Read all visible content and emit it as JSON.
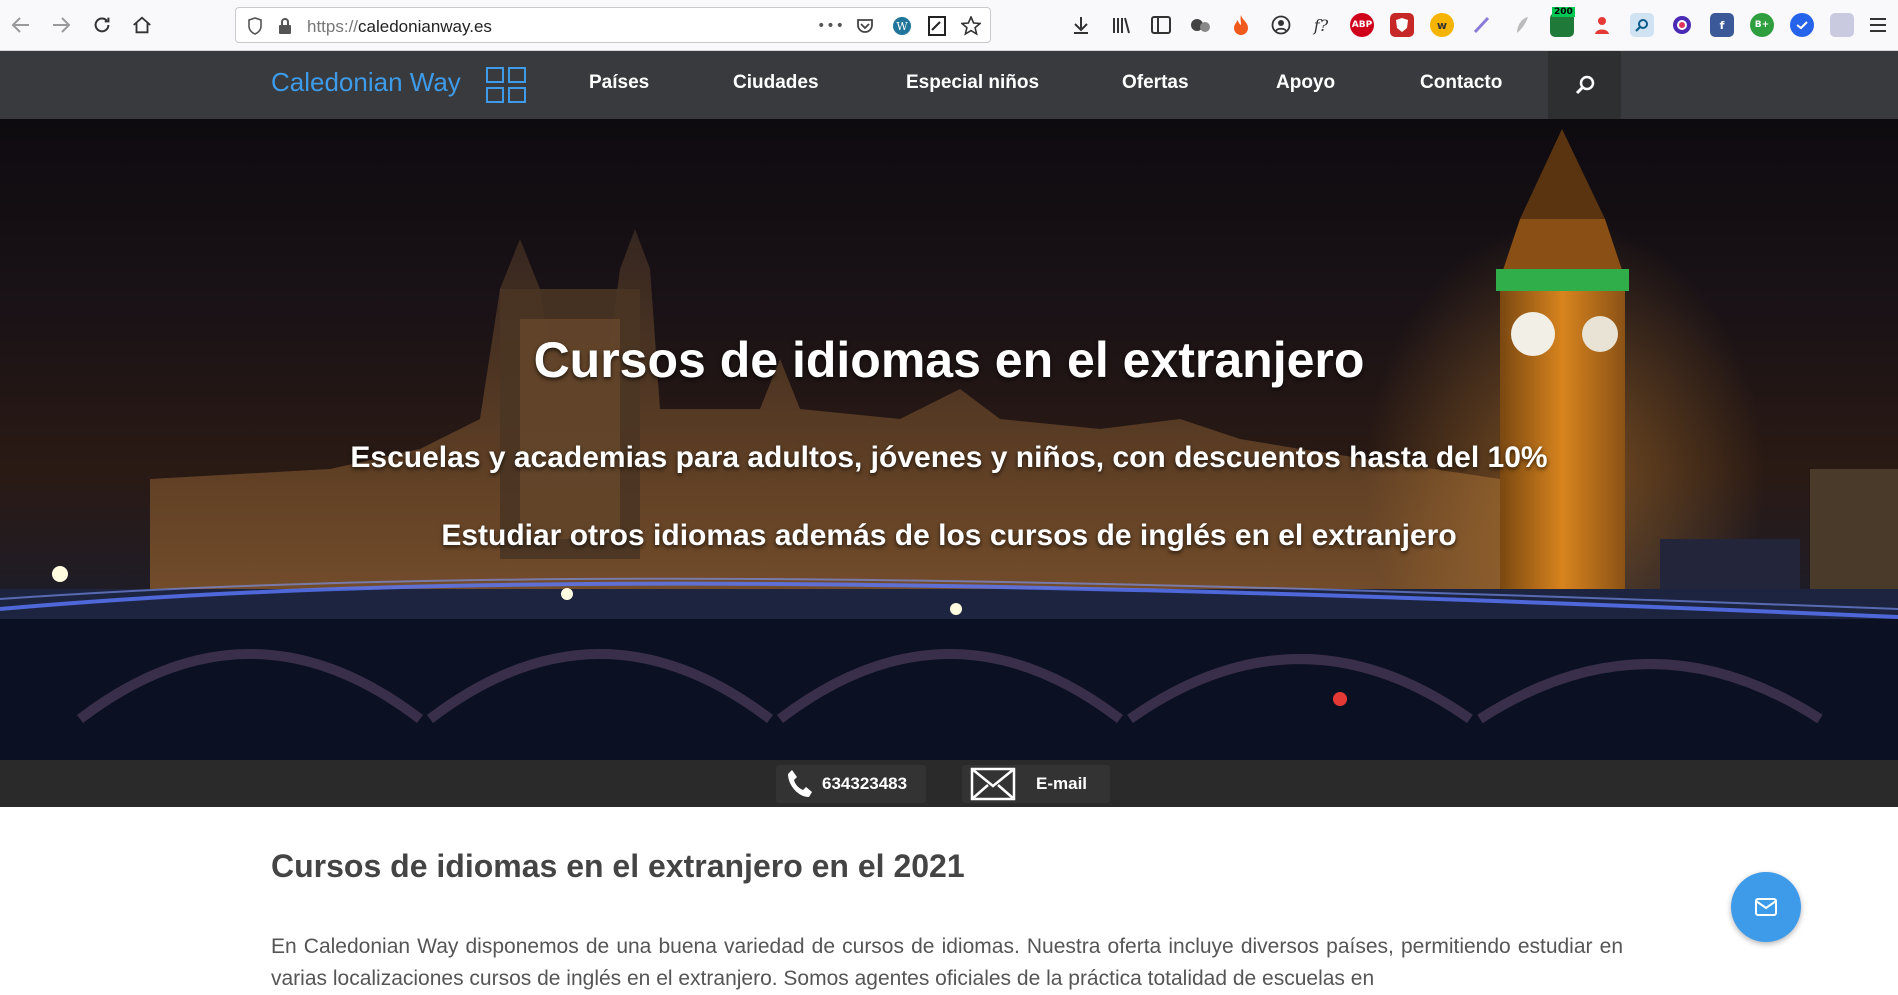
{
  "browser": {
    "url_scheme": "https://",
    "url_host": "caledonianway.es",
    "menu_glyph": "•••",
    "badge_count": "200",
    "extensions": [
      {
        "name": "abp-icon",
        "label": "ABP",
        "color": "#d0021b"
      },
      {
        "name": "brave-icon",
        "label": "",
        "color": "#c62828"
      },
      {
        "name": "word-icon",
        "label": "w",
        "color": "#f5b400"
      },
      {
        "name": "facebook-icon",
        "label": "f",
        "color": "#3b5998"
      },
      {
        "name": "bplus-icon",
        "label": "B+",
        "color": "#2e9e3e"
      }
    ]
  },
  "site": {
    "logo_text": "Caledonian Way",
    "accent_color": "#3d9be9",
    "nav": [
      "Países",
      "Ciudades",
      "Especial niños",
      "Ofertas",
      "Apoyo",
      "Contacto"
    ]
  },
  "hero": {
    "title": "Cursos de idiomas en el extranjero",
    "subtitle1": "Escuelas y academias para adultos, jóvenes y niños, con descuentos hasta del 10%",
    "subtitle2": "Estudiar otros idiomas además de los cursos de inglés en el extranjero"
  },
  "contact": {
    "phone": "634323483",
    "email_label": "E-mail"
  },
  "content": {
    "title": "Cursos de idiomas en el extranjero en el 2021",
    "paragraph": "En Caledonian Way disponemos de una buena variedad de cursos de idiomas. Nuestra oferta incluye diversos países, permitiendo estudiar en varias localizaciones cursos de inglés en el extranjero. Somos agentes oficiales de la práctica totalidad de escuelas en"
  }
}
